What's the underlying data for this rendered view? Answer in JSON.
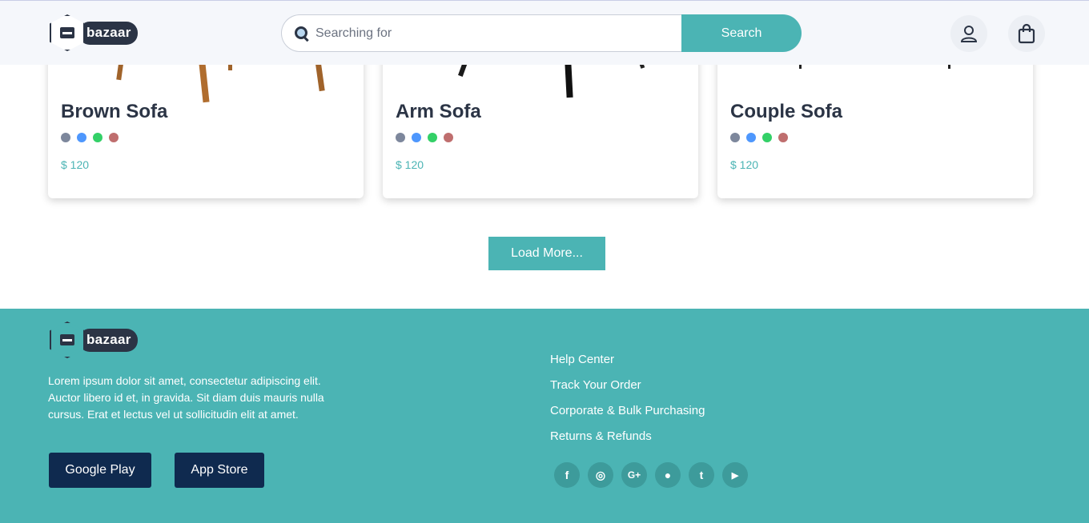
{
  "brand": {
    "name": "bazaar"
  },
  "header": {
    "search": {
      "placeholder": "Searching for",
      "button_label": "Search"
    },
    "icons": [
      "user-icon",
      "shopping-bag-icon"
    ]
  },
  "products": [
    {
      "title": "Brown Sofa",
      "price": "$ 120",
      "colors": [
        "#7d879c",
        "#4e97fd",
        "#33d067",
        "#bf6e6e"
      ]
    },
    {
      "title": "Arm Sofa",
      "price": "$ 120",
      "colors": [
        "#7d879c",
        "#4e97fd",
        "#33d067",
        "#bf6e6e"
      ]
    },
    {
      "title": "Couple Sofa",
      "price": "$ 120",
      "colors": [
        "#7d879c",
        "#4e97fd",
        "#33d067",
        "#bf6e6e"
      ]
    }
  ],
  "load_more_label": "Load More...",
  "footer": {
    "description": "Lorem ipsum dolor sit amet, consectetur adipiscing elit. Auctor libero id et, in gravida. Sit diam duis mauris nulla cursus. Erat et lectus vel ut sollicitudin elit at amet.",
    "app_buttons": {
      "google_play": "Google Play",
      "app_store": "App Store"
    },
    "links": [
      "Help Center",
      "Track Your Order",
      "Corporate & Bulk Purchasing",
      "Returns & Refunds"
    ],
    "social": [
      {
        "icon": "facebook-icon",
        "glyph": "f"
      },
      {
        "icon": "instagram-icon",
        "glyph": "◎"
      },
      {
        "icon": "google-plus-icon",
        "glyph": "G+"
      },
      {
        "icon": "github-icon",
        "glyph": "●"
      },
      {
        "icon": "tumblr-icon",
        "glyph": "t"
      },
      {
        "icon": "youtube-icon",
        "glyph": "▶"
      }
    ]
  },
  "colors": {
    "accent": "#4bb4b4",
    "dark": "#0f2a4f",
    "text": "#2b3445",
    "header_bg": "#f5f7fb"
  }
}
